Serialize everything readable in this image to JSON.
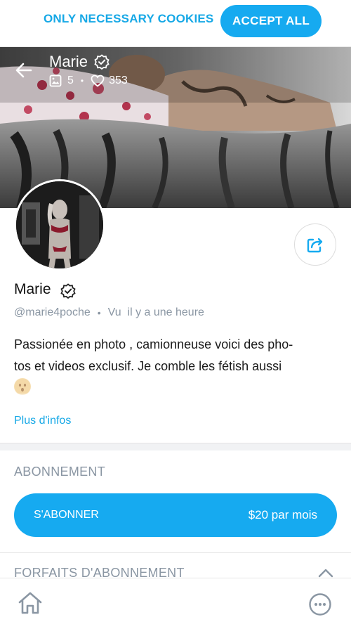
{
  "cookies": {
    "necessary_label": "ONLY NECESSARY COOKIES",
    "accept_label": "ACCEPT ALL"
  },
  "header": {
    "name": "Marie",
    "photos_count": "5",
    "stats_separator": "•",
    "likes_count": "353"
  },
  "profile": {
    "name": "Marie",
    "handle": "@marie4poche",
    "separator": "•",
    "last_seen": "Vu  il y a une heure",
    "bio_line1": "Passionée en photo , camionneuse voici des pho-",
    "bio_line2": "tos et videos exclusif. Je comble les fétish aussi",
    "more_info": "Plus d'infos"
  },
  "subscription": {
    "title": "ABONNEMENT",
    "button_label": "S'ABONNER",
    "price": "$20 par mois",
    "bundles_title": "FORFAITS D'ABONNEMENT"
  },
  "icons": [
    "arrow-left-icon",
    "verified-badge-icon",
    "image-icon",
    "heart-icon",
    "share-icon",
    "chevron-up-icon",
    "home-icon",
    "more-icon"
  ],
  "colors": {
    "accent": "#16aaf0",
    "muted": "#8a96a3"
  }
}
